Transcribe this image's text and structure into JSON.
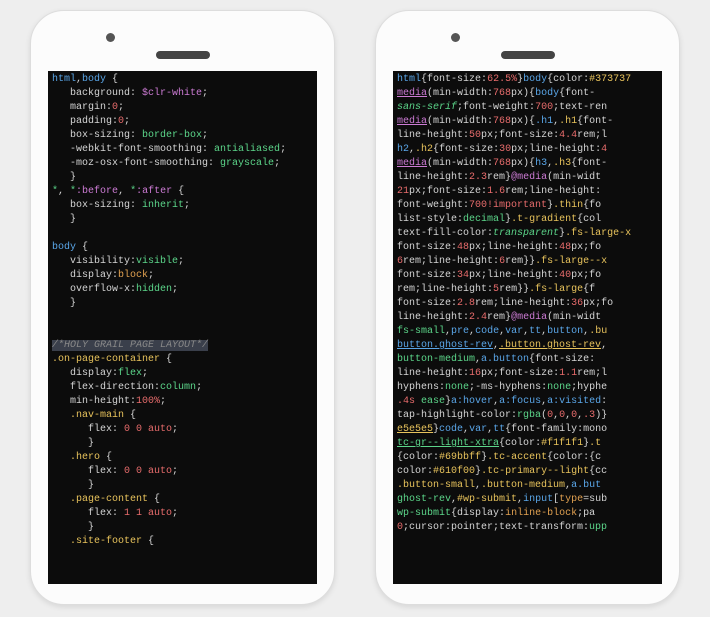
{
  "left_phone": {
    "lines": {
      "l1_sel": "html",
      "l1_comma": ",",
      "l1_body": "body",
      "l1_brace": " {",
      "l2_prop": "   background",
      "l2_val": "$clr-white",
      "l3_prop": "   margin",
      "l3_val": "0",
      "l4_prop": "   padding",
      "l4_val": "0",
      "l5_prop": "   box-sizing",
      "l5_val": "border-box",
      "l6_prop": "   -webkit-font-smoothing",
      "l6_val": "antialiased",
      "l7_prop": "   -moz-osx-font-smoothing",
      "l7_val": "grayscale",
      "l8_brace": "   }",
      "l9a": "*",
      "l9b": "*",
      "l9ba": ":before",
      "l9c": "*",
      "l9ca": ":after",
      "l9_brace": " {",
      "l10_prop": "   box-sizing",
      "l10_val": "inherit",
      "l11_brace": "   }",
      "l13_sel": "body",
      "l13_brace": " {",
      "l14_prop": "   visibility",
      "l14_val": "visible",
      "l15_prop": "   display",
      "l15_val": "block",
      "l16_prop": "   overflow-x",
      "l16_val": "hidden",
      "l17_brace": "   }",
      "cmt": "/*HOLY GRAIL PAGE LAYOUT*/",
      "c1_sel": ".on-page-container",
      "c1_brace": " {",
      "c2_prop": "   display",
      "c2_val": "flex",
      "c3_prop": "   flex-direction",
      "c3_val": "column",
      "c4_prop": "   min-height",
      "c4_val": "100%",
      "c5_sel": "   .nav-main",
      "c5_brace": " {",
      "c6_prop": "      flex",
      "c6_val": "0 0 auto",
      "c7_brace": "      }",
      "c8_sel": "   .hero",
      "c8_brace": " {",
      "c9_prop": "      flex",
      "c9_val": "0 0 auto",
      "c10_brace": "      }",
      "c11_sel": "   .page-content",
      "c11_brace": " {",
      "c12_prop": "      flex",
      "c12_val": "1 1 auto",
      "c13_brace": "      }",
      "c14_sel": "   .site-footer",
      "c14_brace": " {"
    }
  },
  "right_phone": {
    "text": {
      "r1a": "html",
      "r1b": "{",
      "r1c": "font-size",
      "r1d": ":",
      "r1e": "62.5%",
      "r1f": "}",
      "r1g": "body",
      "r1h": "{",
      "r1i": "color",
      "r1j": ":",
      "r1k": "#373737",
      "r2a": "media",
      "r2b": "(min-width:",
      "r2c": "768",
      "r2d": "px){",
      "r2e": "body",
      "r2f": "{",
      "r2g": "font-",
      "r3a": "sans-serif",
      "r3b": ";",
      "r3c": "font-weight",
      "r3d": ":",
      "r3e": "700",
      "r3f": ";text-ren",
      "r4a": "media",
      "r4b": "(min-width:",
      "r4c": "768",
      "r4d": "px){",
      "r4e": ".h1",
      "r4f": ",",
      "r4g": ".h1",
      "r4h": "{",
      "r4i": "font-",
      "r5a": "line-height",
      "r5b": ":",
      "r5c": "50",
      "r5d": "px;",
      "r5e": "font-size",
      "r5f": ":",
      "r5g": "4.4",
      "r5h": "rem;",
      "r5i": "l",
      "r6a": "h2",
      "r6b": ",",
      "r6c": ".h2",
      "r6d": "{",
      "r6e": "font-size",
      "r6f": ":",
      "r6g": "30",
      "r6h": "px;",
      "r6i": "line-height",
      "r6j": ":",
      "r6k": "4",
      "r7a": "media",
      "r7b": "(min-width:",
      "r7c": "768",
      "r7d": "px){",
      "r7e": "h3",
      "r7f": ",",
      "r7g": ".h3",
      "r7h": "{",
      "r7i": "font-",
      "r8a": "line-height",
      "r8b": ":",
      "r8c": "2.3",
      "r8d": "rem}",
      "r8e": "@media",
      "r8f": "(min-widt",
      "r9a": "21",
      "r9b": "px;",
      "r9c": "font-size",
      "r9d": ":",
      "r9e": "1.6",
      "r9f": "rem;",
      "r9g": "line-height",
      "r9h": ":",
      "r10a": "font-weight",
      "r10b": ":",
      "r10c": "700",
      "r10d": "!important",
      "r10e": "}",
      "r10f": ".thin",
      "r10g": "{fo",
      "r11a": "list-style",
      "r11b": ":",
      "r11c": "decimal",
      "r11d": "}",
      "r11e": ".t-gradient",
      "r11f": "{col",
      "r12a": "text-fill-color",
      "r12b": ":",
      "r12c": "transparent",
      "r12d": "}",
      "r12e": ".fs-large-x",
      "r13a": "font-size",
      "r13b": ":",
      "r13c": "48",
      "r13d": "px;",
      "r13e": "line-height",
      "r13f": ":",
      "r13g": "48",
      "r13h": "px;fo",
      "r14a": "6",
      "r14b": "rem;",
      "r14c": "line-height",
      "r14d": ":",
      "r14e": "6",
      "r14f": "rem}}",
      "r14g": ".fs-large--x",
      "r15a": "font-size",
      "r15b": ":",
      "r15c": "34",
      "r15d": "px;",
      "r15e": "line-height",
      "r15f": ":",
      "r15g": "40",
      "r15h": "px;fo",
      "r16a": "rem;",
      "r16b": "line-height",
      "r16c": ":",
      "r16d": "5",
      "r16e": "rem}}",
      "r16f": ".fs-large",
      "r16g": "{f",
      "r17a": "font-size",
      "r17b": ":",
      "r17c": "2.8",
      "r17d": "rem;",
      "r17e": "line-height",
      "r17f": ":",
      "r17g": "36",
      "r17h": "px;fo",
      "r18a": "line-height",
      "r18b": ":",
      "r18c": "2.4",
      "r18d": "rem}",
      "r18e": "@media",
      "r18f": "(min-widt",
      "r19a": "fs-small",
      "r19b": ",",
      "r19c": "pre",
      "r19d": ",",
      "r19e": "code",
      "r19f": ",",
      "r19g": "var",
      "r19h": ",",
      "r19i": "tt",
      "r19j": ",",
      "r19k": "button",
      "r19l": ",",
      "r19m": ".bu",
      "r20a": "button.ghost-rev",
      "r20b": ",",
      "r20c": ".button.ghost-rev",
      "r20d": ",",
      "r21a": "button-medium",
      "r21b": ",",
      "r21c": "a.button",
      "r21d": "{",
      "r21e": "font-size",
      "r21f": ":",
      "r22a": "line-height",
      "r22b": ":",
      "r22c": "16",
      "r22d": "px;",
      "r22e": "font-size",
      "r22f": ":",
      "r22g": "1.1",
      "r22h": "rem;l",
      "r23a": "hyphens",
      "r23b": ":",
      "r23c": "none",
      "r23d": ";",
      "r23e": "-ms-hyphens",
      "r23f": ":",
      "r23g": "none",
      "r23h": ";hyphe",
      "r24a": ".4s",
      "r24b": " ease",
      "r24c": "}",
      "r24d": "a:hover",
      "r24e": ",",
      "r24f": "a:focus",
      "r24g": ",",
      "r24h": "a:visited",
      "r24i": ":",
      "r25a": "tap-highlight-color",
      "r25b": ":",
      "r25c": "rgba",
      "r25d": "(",
      "r25e": "0",
      "r25f": ",",
      "r25g": "0",
      "r25h": ",",
      "r25i": "0",
      "r25j": ",",
      "r25k": ".3",
      "r25l": ")}",
      "r26a": "e5e5e5",
      "r26b": "}",
      "r26c": "code",
      "r26d": ",",
      "r26e": "var",
      "r26f": ",",
      "r26g": "tt",
      "r26h": "{",
      "r26i": "font-family",
      "r26j": ":mono",
      "r27a": "tc-gr--light-xtra",
      "r27b": "{",
      "r27c": "color",
      "r27d": ":",
      "r27e": "#f1f1f1",
      "r27f": "}",
      "r27g": ".t",
      "r28a": "{",
      "r28b": "color",
      "r28c": ":",
      "r28d": "#69bbff",
      "r28e": "}",
      "r28f": ".tc-accent",
      "r28g": "{",
      "r28h": "color",
      "r28i": ":{c",
      "r29a": "color",
      "r29b": ":",
      "r29c": "#610f00",
      "r29d": "}",
      "r29e": ".tc-primary--light",
      "r29f": "{cc",
      "r30a": ".button-small",
      "r30b": ",",
      "r30c": ".button-medium",
      "r30d": ",",
      "r30e": "a.but",
      "r31a": "ghost-rev",
      "r31b": ",",
      "r31c": "#wp-submit",
      "r31d": ",",
      "r31e": "input",
      "r31f": "[",
      "r31g": "type",
      "r31h": "=sub",
      "r32a": "wp-submit",
      "r32b": "{",
      "r32c": "display",
      "r32d": ":",
      "r32e": "inline-block",
      "r32f": ";pa",
      "r33a": "0",
      "r33b": ";cursor:pointer;text-transform:",
      "r33c": "upp"
    }
  }
}
